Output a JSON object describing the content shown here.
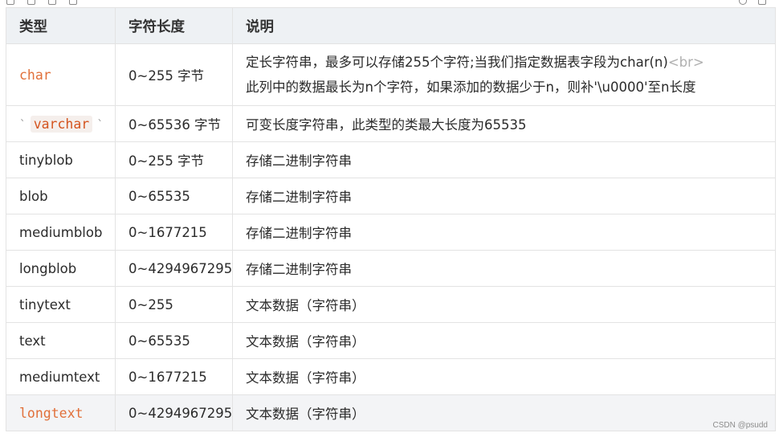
{
  "table": {
    "headers": [
      "类型",
      "字符长度",
      "说明"
    ],
    "rows": [
      {
        "type": "char",
        "length": "0~255 字节",
        "desc_line1": "定长字符串，最多可以存储255个字符;当我们指定数据表字段为char(n)",
        "desc_br": "<br>",
        "desc_line2": "此列中的数据最长为n个字符，如果添加的数据少于n，则补'\\u0000'至n长度"
      },
      {
        "type": "varchar",
        "tick_left": "`",
        "tick_right": "`",
        "length": "0~65536 字节",
        "desc": "可变长度字符串，此类型的类最大长度为65535"
      },
      {
        "type": "tinyblob",
        "length": "0~255 字节",
        "desc": "存储二进制字符串"
      },
      {
        "type": "blob",
        "length": "0~65535",
        "desc": "存储二进制字符串"
      },
      {
        "type": "mediumblob",
        "length": "0~1677215",
        "desc": "存储二进制字符串"
      },
      {
        "type": "longblob",
        "length": "0~4294967295",
        "desc": "存储二进制字符串"
      },
      {
        "type": "tinytext",
        "length": "0~255",
        "desc": "文本数据（字符串）"
      },
      {
        "type": "text",
        "length": "0~65535",
        "desc": "文本数据（字符串）"
      },
      {
        "type": "mediumtext",
        "length": "0~1677215",
        "desc": "文本数据（字符串）"
      },
      {
        "type": "longtext",
        "length": "0~4294967295",
        "desc": "文本数据（字符串）"
      }
    ]
  },
  "watermark": "CSDN @psudd",
  "colors": {
    "header_bg": "#eef1f4",
    "border": "#e3e3e3",
    "code_orange": "#e1703a",
    "last_row_bg": "#f3f4f6"
  },
  "icons": [
    "copy-icon",
    "copy-icon",
    "copy-icon",
    "copy-icon",
    "search-icon",
    "menu-icon"
  ]
}
